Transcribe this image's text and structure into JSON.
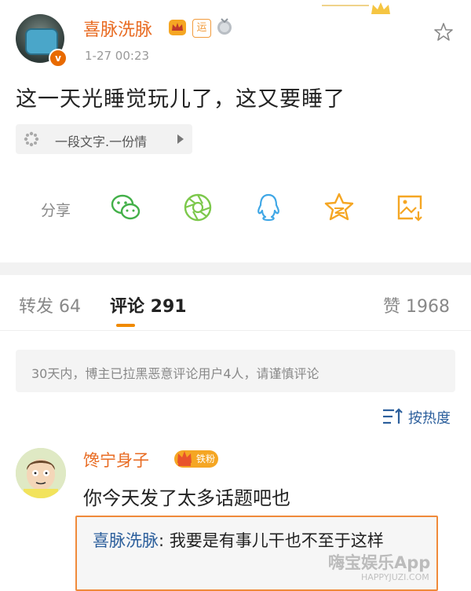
{
  "post": {
    "author": "喜脉洗脉",
    "yun_badge": "运",
    "timestamp": "1-27 00:23",
    "text": "这一天光睡觉玩儿了，这又要睡了",
    "music_chip": "一段文字.一份情"
  },
  "share": {
    "label": "分享",
    "targets": [
      "wechat-icon",
      "moments-icon",
      "qq-icon",
      "qzone-icon",
      "save-image-icon"
    ]
  },
  "tabs": {
    "repost": "转发 64",
    "comments": "评论 291",
    "likes": "赞 1968"
  },
  "notice": "30天内，博主已拉黑恶意评论用户4人，请谨慎评论",
  "sort": {
    "label": "按热度"
  },
  "comment": {
    "author": "馋宁身子",
    "fan_badge": "铁粉",
    "text": "你今天发了太多话题吧也",
    "reply_author": "喜脉洗脉",
    "reply_text": ": 我要是有事儿干也不至于这样"
  },
  "watermark": {
    "main": "嗨宝娱乐App",
    "sub": "HAPPYJUZI.COM"
  },
  "colors": {
    "accent_orange": "#e86b22",
    "link_blue": "#2c5f9c",
    "highlight_box": "#f08a3a"
  }
}
